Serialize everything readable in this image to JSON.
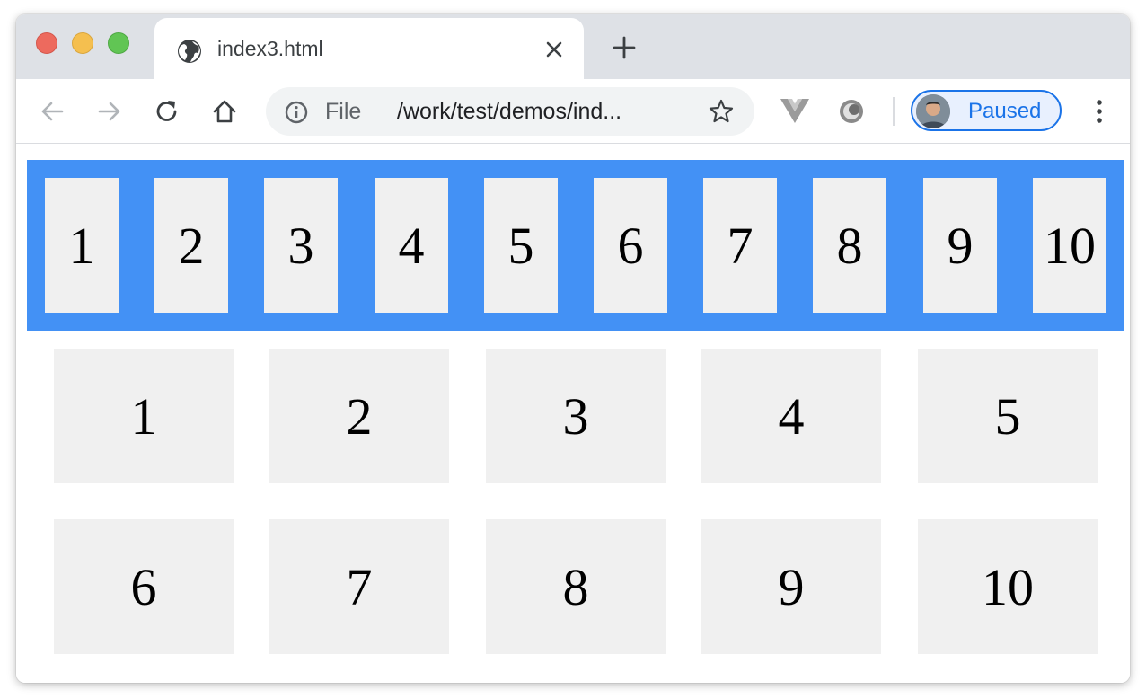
{
  "browser": {
    "tab_title": "index3.html",
    "omnibox": {
      "scheme_label": "File",
      "url": "/work/test/demos/ind..."
    },
    "profile_label": "Paused",
    "icons": {
      "tab_favicon": "globe-icon",
      "tab_close": "close-icon",
      "new_tab": "plus-icon",
      "back": "arrow-left-icon",
      "forward": "arrow-right-icon",
      "reload": "reload-icon",
      "home": "home-icon",
      "site_info": "info-icon",
      "bookmark": "star-icon",
      "extension_1": "vue-devtools-icon",
      "extension_2": "extension-circle-icon",
      "menu": "kebab-menu-icon"
    },
    "colors": {
      "accent": "#1a73e8",
      "tabstrip": "#dee1e6",
      "flex_container": "#4391f5",
      "item_bg": "#f0f0f0"
    }
  },
  "page": {
    "flex_items": [
      "1",
      "2",
      "3",
      "4",
      "5",
      "6",
      "7",
      "8",
      "9",
      "10"
    ],
    "grid_items": [
      "1",
      "2",
      "3",
      "4",
      "5",
      "6",
      "7",
      "8",
      "9",
      "10"
    ]
  }
}
